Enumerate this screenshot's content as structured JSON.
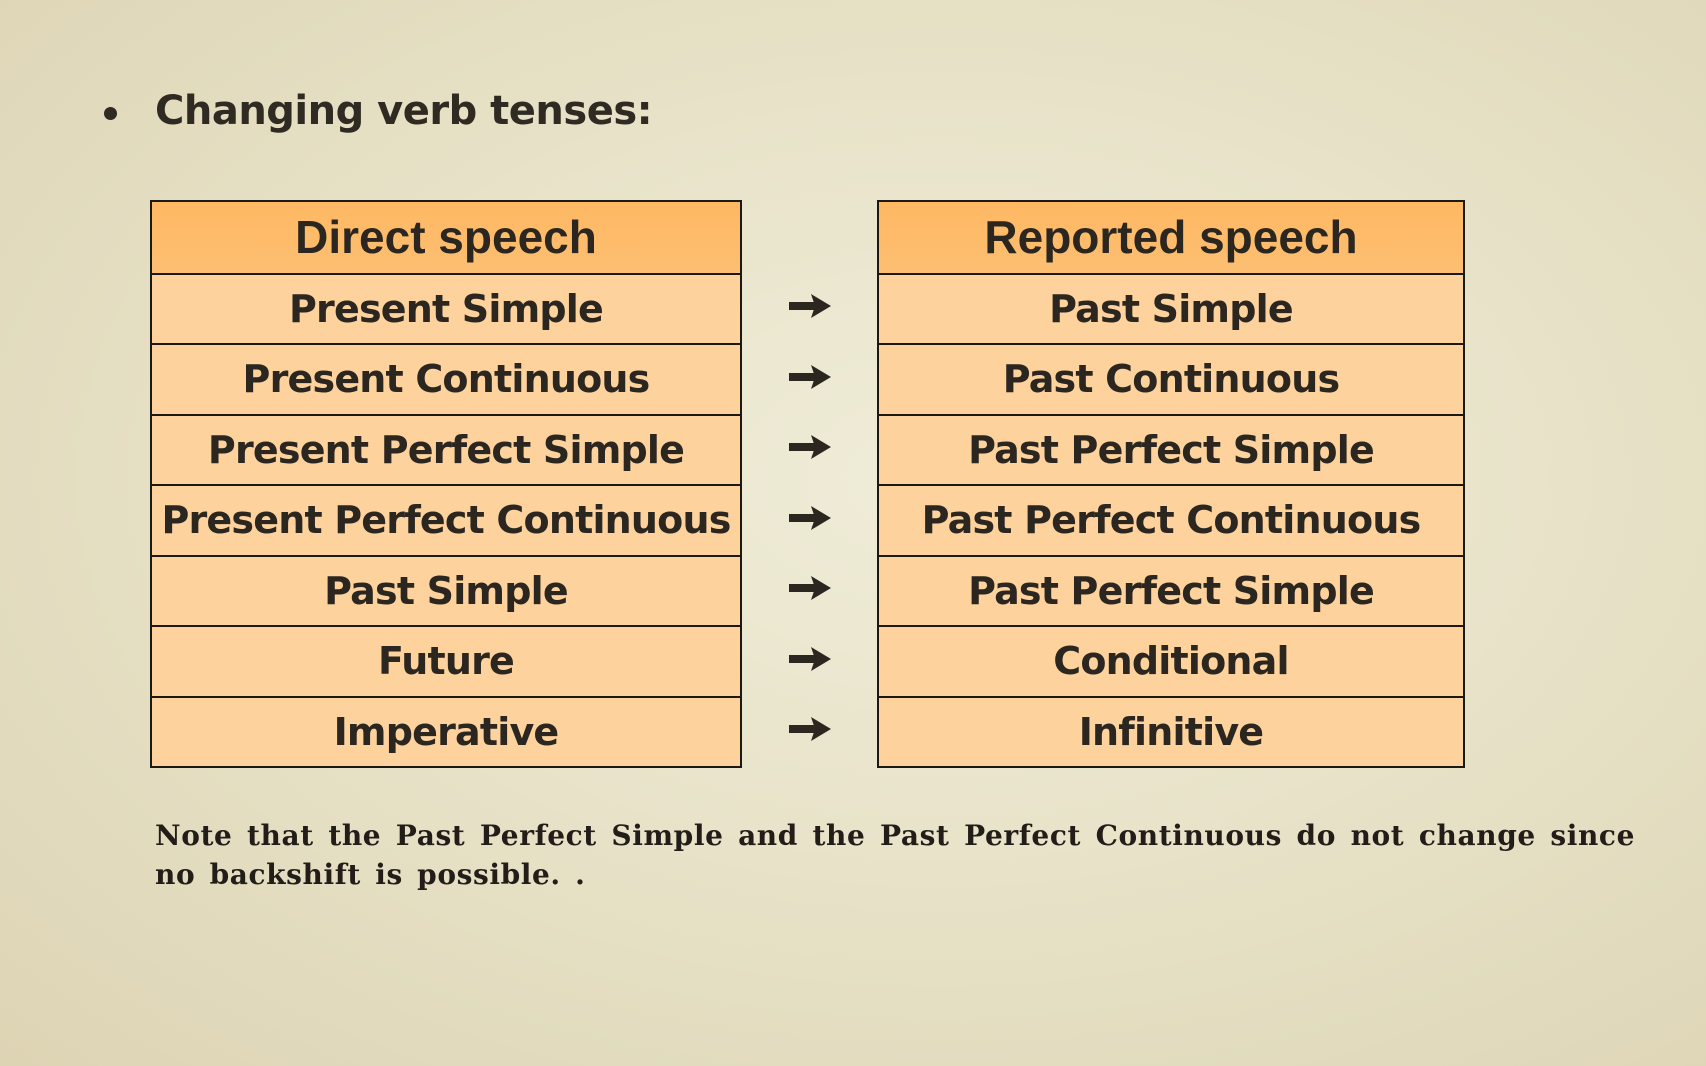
{
  "heading": {
    "bullet_icon": "bullet-dot-icon",
    "text": "Changing verb tenses:"
  },
  "tables": {
    "direct": {
      "header": "Direct speech",
      "rows": [
        "Present Simple",
        "Present Continuous",
        "Present Perfect Simple",
        "Present Perfect Continuous",
        "Past Simple",
        "Future",
        "Imperative"
      ]
    },
    "reported": {
      "header": "Reported speech",
      "rows": [
        "Past Simple",
        "Past Continuous",
        "Past Perfect Simple",
        "Past Perfect Continuous",
        "Past Perfect Simple",
        "Conditional",
        "Infinitive"
      ]
    },
    "arrow_icon": "right-arrow-icon"
  },
  "note": "Note that the Past Perfect Simple and the Past Perfect Continuous do not change since no backshift is possible. .",
  "colors": {
    "header_fill": "#fdb965",
    "row_fill": "#fdd29c",
    "border": "#1c1814",
    "text": "#2b2620",
    "background": "#e8e3c9"
  }
}
